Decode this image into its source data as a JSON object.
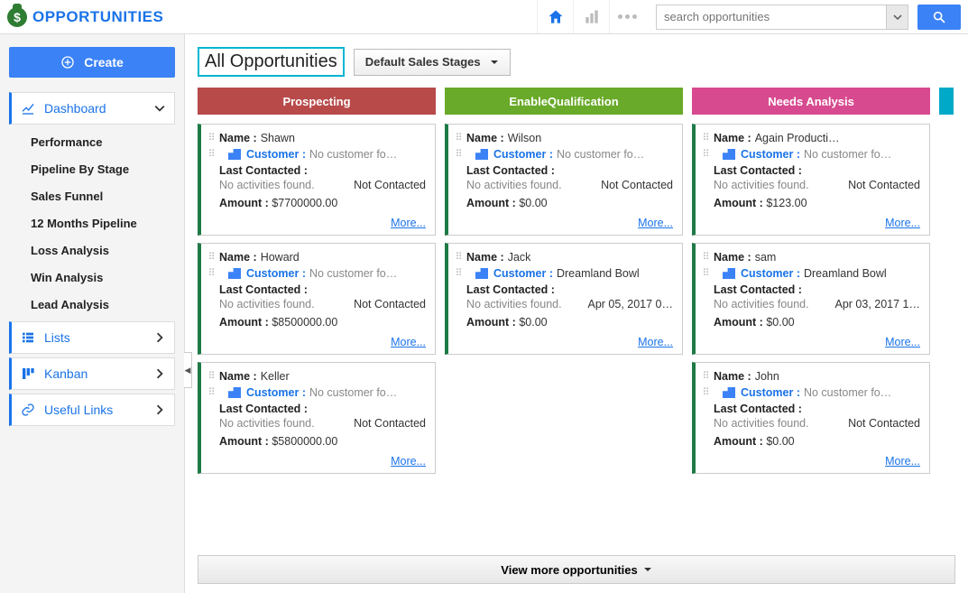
{
  "app": {
    "title": "OPPORTUNITIES"
  },
  "search": {
    "placeholder": "search opportunities"
  },
  "sidebar": {
    "create_label": "Create",
    "dashboard_label": "Dashboard",
    "dashboard_items": [
      {
        "label": "Performance"
      },
      {
        "label": "Pipeline By Stage"
      },
      {
        "label": "Sales Funnel"
      },
      {
        "label": "12 Months Pipeline"
      },
      {
        "label": "Loss Analysis"
      },
      {
        "label": "Win Analysis"
      },
      {
        "label": "Lead Analysis"
      }
    ],
    "lists_label": "Lists",
    "kanban_label": "Kanban",
    "links_label": "Useful Links"
  },
  "header": {
    "page_title": "All Opportunities",
    "stages_label": "Default Sales Stages"
  },
  "labels": {
    "name": "Name :",
    "customer": "Customer :",
    "last_contacted": "Last Contacted :",
    "amount": "Amount :",
    "more": "More...",
    "view_more": "View more opportunities"
  },
  "columns": [
    {
      "title": "Prospecting",
      "color": "#b84a4a",
      "accent": "#1e7a46",
      "cards": [
        {
          "name": "Shawn",
          "customer": "No customer fo…",
          "activities": "No activities found.",
          "contact": "Not Contacted",
          "amount": "$7700000.00"
        },
        {
          "name": "Howard",
          "customer": "No customer fo…",
          "activities": "No activities found.",
          "contact": "Not Contacted",
          "amount": "$8500000.00"
        },
        {
          "name": "Keller",
          "customer": "No customer fo…",
          "activities": "No activities found.",
          "contact": "Not Contacted",
          "amount": "$5800000.00"
        }
      ]
    },
    {
      "title": "EnableQualification",
      "color": "#6aaa2a",
      "accent": "#1e7a46",
      "cards": [
        {
          "name": "Wilson",
          "customer": "No customer fo…",
          "activities": "No activities found.",
          "contact": "Not Contacted",
          "amount": "$0.00"
        },
        {
          "name": "Jack",
          "customer": "Dreamland Bowl",
          "activities": "No activities found.",
          "contact": "Apr 05, 2017 0…",
          "amount": "$0.00"
        }
      ]
    },
    {
      "title": "Needs Analysis",
      "color": "#d84a8f",
      "accent": "#1e7a46",
      "cards": [
        {
          "name": "Again Producti…",
          "customer": "No customer fo…",
          "activities": "No activities found.",
          "contact": "Not Contacted",
          "amount": "$123.00"
        },
        {
          "name": "sam",
          "customer": "Dreamland Bowl",
          "activities": "No activities found.",
          "contact": "Apr 03, 2017 1…",
          "amount": "$0.00"
        },
        {
          "name": "John",
          "customer": "No customer fo…",
          "activities": "No activities found.",
          "contact": "Not Contacted",
          "amount": "$0.00"
        }
      ]
    },
    {
      "title": "",
      "color": "#00a9c7",
      "accent": "#1e7a46",
      "cards": []
    }
  ]
}
